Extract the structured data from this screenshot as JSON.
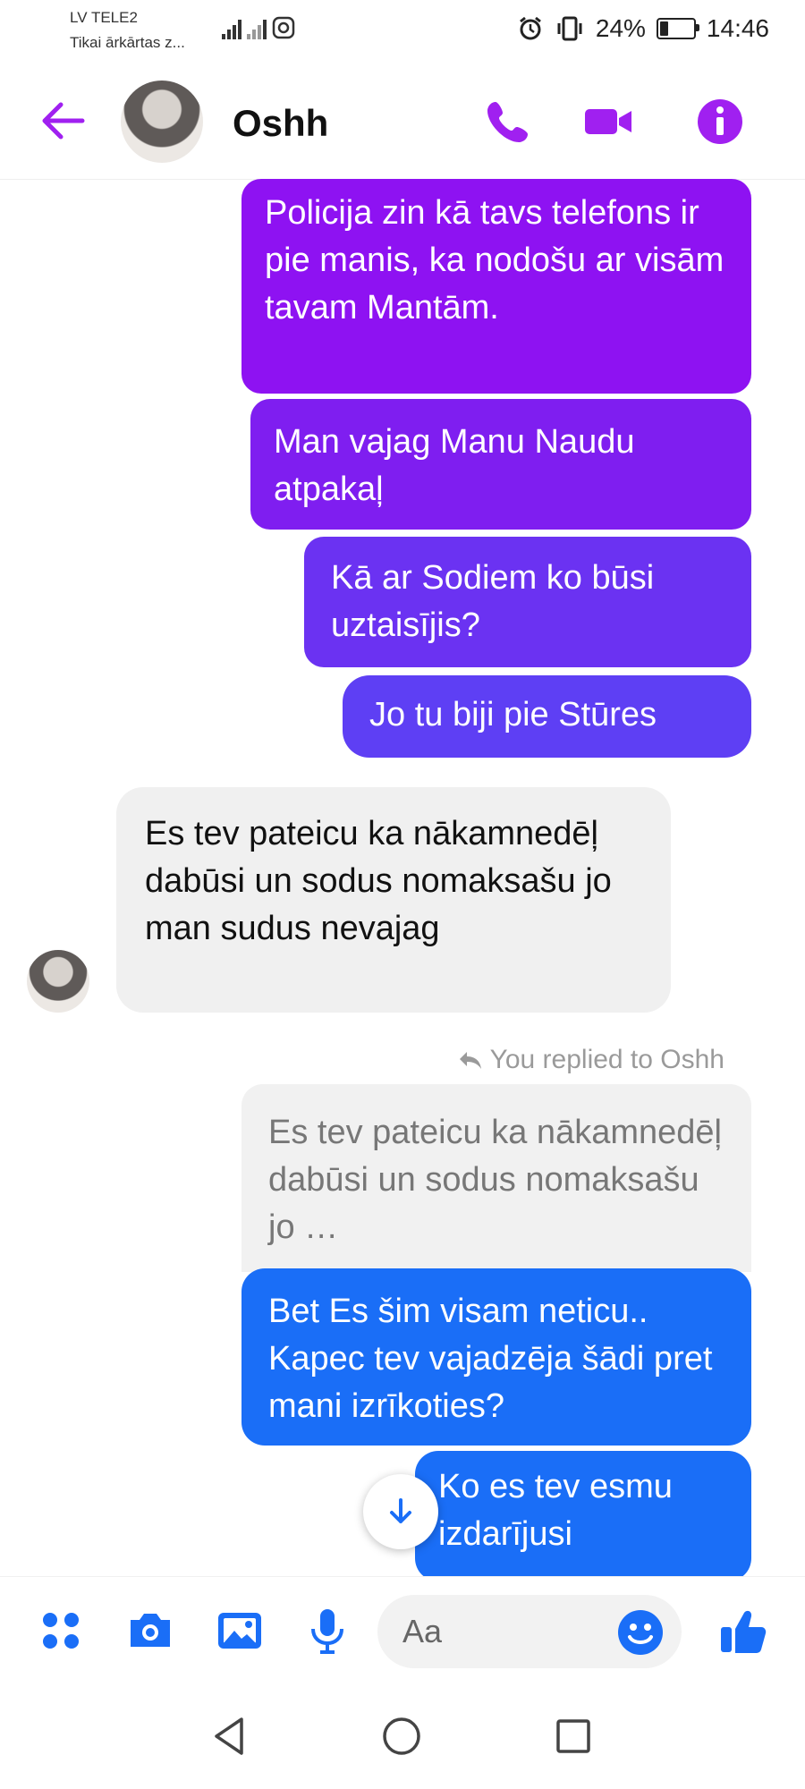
{
  "status_bar": {
    "carrier_line1": "LV TELE2",
    "carrier_line2": "Tikai ārkārtas z...",
    "battery_percent": "24%",
    "battery_level": 0.24,
    "time": "14:46"
  },
  "header": {
    "contact_name": "Oshh",
    "icons": [
      "back-arrow-icon",
      "phone-icon",
      "video-camera-icon",
      "info-icon"
    ]
  },
  "messages": [
    {
      "direction": "outgoing",
      "text": "Policija zin kā tavs telefons ir pie manis, ka nodošu ar visām tavam Mantām."
    },
    {
      "direction": "outgoing",
      "text": "Man vajag Manu Naudu atpakaļ"
    },
    {
      "direction": "outgoing",
      "text": "Kā ar Sodiem ko būsi uztaisījis?"
    },
    {
      "direction": "outgoing",
      "text": "Jo tu biji pie Stūres"
    },
    {
      "direction": "incoming",
      "text": "Es tev pateicu ka nākamnedēļ dabūsi un sodus nomaksašu jo  man sudus nevajag"
    },
    {
      "direction": "outgoing",
      "text": "Bet Es šim visam neticu.. Kapec tev vajadzēja šādi pret mani izrīkoties?"
    },
    {
      "direction": "outgoing",
      "text": "Ko es tev esmu izdarījusi"
    }
  ],
  "reply": {
    "label": "You replied to Oshh",
    "quoted_text": "Es tev pateicu ka nākamnedēļ dabūsi un sodus nomaksašu jo  …"
  },
  "composer": {
    "placeholder": "Aa",
    "icons": [
      "menu-dots-icon",
      "camera-icon",
      "gallery-icon",
      "microphone-icon",
      "emoji-icon",
      "thumbs-up-icon"
    ]
  },
  "navigation": {
    "icons": [
      "back-triangle-icon",
      "home-circle-icon",
      "recents-square-icon"
    ]
  },
  "colors": {
    "accent_purple": "#a020f0",
    "bubble_purple": "#8e12f2",
    "bubble_violet": "#5e3ff4",
    "bubble_blue": "#1a6ef7",
    "icon_blue": "#1a6ef7",
    "incoming_bg": "#f0f0f0"
  }
}
